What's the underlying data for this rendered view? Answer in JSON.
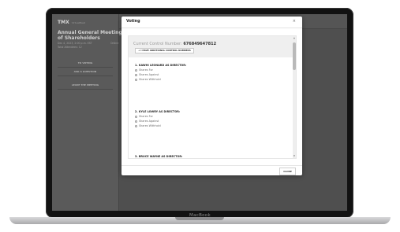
{
  "device": {
    "brand_label": "MacBook"
  },
  "app": {
    "logo": "TMX",
    "logo_sub": "VirtualMeet",
    "meeting_title": "Annual General Meeting of Shareholders",
    "meeting_date": "Dec 4, 2023, 2:00 p.m. EST",
    "live_label": "Online",
    "total_attendees": "Total Attendees: 12",
    "buttons": {
      "voting": "TO VOTING",
      "ask": "ASK A QUESTION",
      "leave": "LEAVE THE MEETING"
    }
  },
  "modal": {
    "title": "Voting",
    "close_icon": "×",
    "control_label": "Current Control Number:",
    "control_number": "676849647812",
    "additional_button": "+ I HAVE ADDITIONAL CONTROL NUMBERS",
    "questions": [
      {
        "title": "1. KAWHI LEONARD AS DIRECTOR:",
        "options": [
          "Shares For",
          "Shares Against",
          "Shares Withhold"
        ]
      },
      {
        "title": "2. KYLE LOWRY AS DIRECTOR:",
        "options": [
          "Shares For",
          "Shares Against",
          "Shares Withhold"
        ]
      },
      {
        "title": "3. BRUCE WAYNE AS DIRECTOR:",
        "options": []
      }
    ],
    "close_button": "CLOSE"
  },
  "colors": {
    "overlay": "#4a4a4a",
    "modal_bg": "#ffffff",
    "control_box": "#efefef"
  }
}
